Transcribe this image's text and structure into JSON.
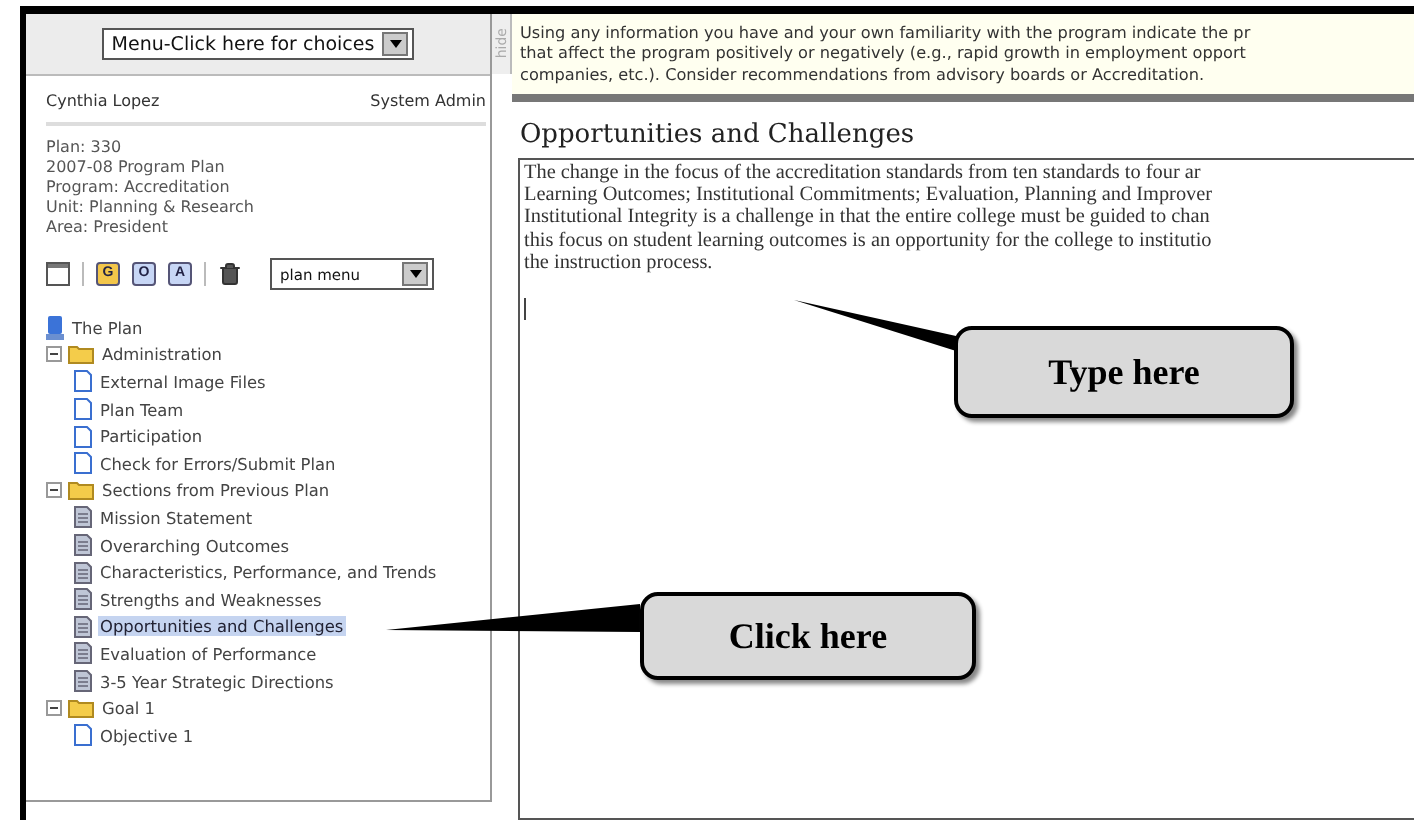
{
  "sidebar": {
    "menu_select": "Menu-Click here for choices",
    "hide_label": "hide",
    "user": {
      "name": "Cynthia Lopez",
      "role": "System Admin"
    },
    "info": [
      "Plan: 330",
      "2007-08 Program Plan",
      "Program: Accreditation",
      "Unit: Planning & Research",
      "Area: President"
    ],
    "toolbar": {
      "letter_buttons": [
        "G",
        "O",
        "A"
      ],
      "plan_select": "plan menu"
    },
    "tree": {
      "label": "The Plan",
      "children": [
        {
          "label": "Administration",
          "kind": "folder",
          "expanded": true,
          "selected": false,
          "children": [
            {
              "label": "External Image Files",
              "kind": "page",
              "selected": false
            },
            {
              "label": "Plan Team",
              "kind": "page",
              "selected": false
            },
            {
              "label": "Participation",
              "kind": "page",
              "selected": false
            },
            {
              "label": "Check for Errors/Submit Plan",
              "kind": "page",
              "selected": false
            }
          ]
        },
        {
          "label": "Sections from Previous Plan",
          "kind": "folder",
          "expanded": true,
          "selected": false,
          "children": [
            {
              "label": "Mission Statement",
              "kind": "prior",
              "selected": false
            },
            {
              "label": "Overarching Outcomes",
              "kind": "prior",
              "selected": false
            },
            {
              "label": "Characteristics, Performance, and Trends",
              "kind": "prior",
              "selected": false
            },
            {
              "label": "Strengths and Weaknesses",
              "kind": "prior",
              "selected": false
            },
            {
              "label": "Opportunities and Challenges",
              "kind": "prior",
              "selected": true
            },
            {
              "label": "Evaluation of Performance",
              "kind": "prior",
              "selected": false
            },
            {
              "label": "3-5 Year Strategic Directions",
              "kind": "prior",
              "selected": false
            }
          ]
        },
        {
          "label": "Goal 1",
          "kind": "folder",
          "expanded": true,
          "selected": false,
          "children": [
            {
              "label": "Objective 1",
              "kind": "page",
              "selected": false
            }
          ]
        }
      ]
    }
  },
  "main": {
    "instructions": [
      "Using any information you have and your own familiarity with the program indicate the pr",
      "that affect the program positively or negatively (e.g., rapid growth in employment opport",
      "companies, etc.). Consider recommendations from advisory boards or Accreditation."
    ],
    "title": "Opportunities and Challenges",
    "editor_lines": [
      "The change in the focus of the accreditation standards  from ten standards to four ar",
      "Learning Outcomes; Institutional Commitments; Evaluation, Planning and Improver",
      "Institutional Integrity is a challenge in that the entire college must be guided to chan",
      "this focus on student learning outcomes is an opportunity for the college to institutio",
      "the instruction process."
    ]
  },
  "callouts": [
    {
      "text": "Type here"
    },
    {
      "text": "Click here"
    }
  ]
}
